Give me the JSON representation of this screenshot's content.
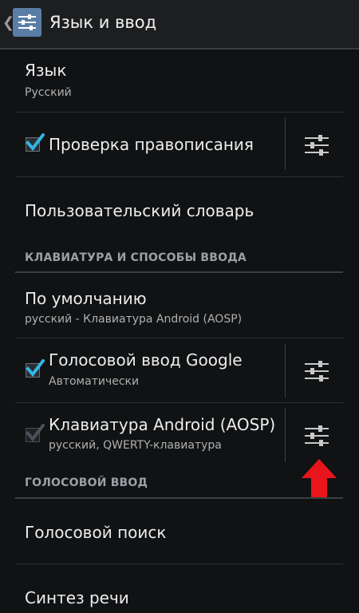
{
  "actionbar": {
    "title": "Язык и ввод",
    "back_glyph": "❮",
    "icon": "settings-sliders-icon"
  },
  "language": {
    "title": "Язык",
    "value": "Русский"
  },
  "spellcheck": {
    "label": "Проверка правописания",
    "checked": true
  },
  "user_dictionary": {
    "label": "Пользовательский словарь"
  },
  "section_keyboard": {
    "label": "КЛАВИАТУРА И СПОСОБЫ ВВОДА"
  },
  "default_input": {
    "title": "По умолчанию",
    "value": "русский - Клавиатура Android (AOSP)"
  },
  "google_voice": {
    "title": "Голосовой ввод Google",
    "subtitle": "Автоматически",
    "checked": true
  },
  "android_keyboard": {
    "title": "Клавиатура Android (AOSP)",
    "subtitle": "русский, QWERTY-клавиатура",
    "checked": true,
    "disabled": true
  },
  "section_voice": {
    "label": "ГОЛОСОВОЙ ВВОД"
  },
  "voice_search": {
    "label": "Голосовой поиск"
  },
  "tts": {
    "label": "Синтез речи"
  },
  "colors": {
    "accent": "#33b5e5",
    "arrow": "#e8151c",
    "background": "#101214"
  }
}
